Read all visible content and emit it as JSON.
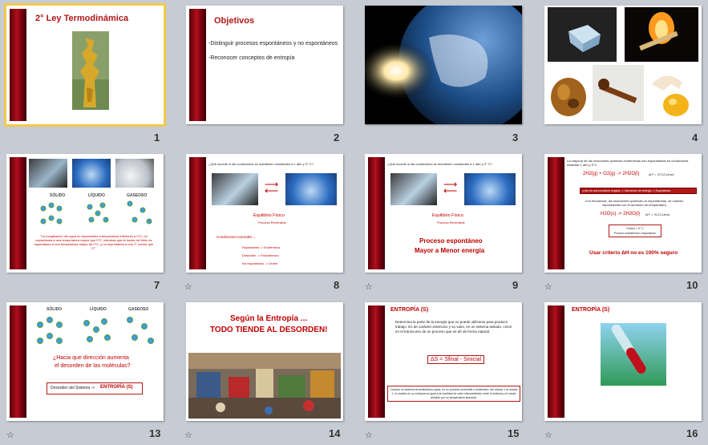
{
  "slides": [
    {
      "num": "1",
      "title": "2° Ley Termodinámica"
    },
    {
      "num": "2",
      "title": "Objetivos",
      "lines": [
        "-Distinguir procesos espontáneos y no espontáneos",
        "-Reconocer conceptos de entropía"
      ]
    },
    {
      "num": "3"
    },
    {
      "num": "4"
    },
    {
      "num": "7",
      "labels": [
        "SÓLIDO",
        "LÍQUIDO",
        "GASEOSO"
      ],
      "quote": "\"La congelación del agua es espontánea a temperatura inferiores a 0°C; no espontánea a una temperatura mayor que 0°C, mientras que la fusión del hielo es espontánea a una temperatura mayor de 0°C, y no espontánea a una T° menor que 0°\""
    },
    {
      "num": "8",
      "question": "¿Qué sucede si las condiciones se mantienen constantes a 1 atm y 0° C?",
      "eq": "Equilibrio Físico",
      "eq_sub": "Proceso Reversible",
      "cond": "Condiciones normales ...",
      "rows": [
        "Espontáneo -> Exotérmico",
        "Desorden -> Endotérmico",
        "No espontáneo -> Orden"
      ]
    },
    {
      "num": "9",
      "question": "¿Qué sucede si las condiciones se mantienen constantes a 1 atm y 0° C?",
      "eq": "Equilibrio Físico",
      "eq_sub": "Proceso Reversible",
      "big": "Proceso espontáneo",
      "big2": "Mayor a Menor energía"
    },
    {
      "num": "10",
      "intro": "La mayoría de las reacciones químicas exotérmicas son espontáneas en condiciones estándar 1 atm y 0°C",
      "eq1": "2H2(g) + O2(g) -> 2H2O(l)",
      "dh1": "ΔH° = -571,6 kJ/mol",
      "box1": "¡¡¡No es una condición mágica -> Liberación de energía -> Espontánea",
      "mid": "Con frecuencia, las reacciones químicas no espontáneas, se vuelven espontáneas con el aumento de temperatura",
      "eq2": "H2O(s) -> 2H2O(l)",
      "dh2": "ΔH° = +6.01 kJ/mol",
      "box2a": "Fusión > 0° C",
      "box2b": "Proceso endotérmico espontáneo",
      "criterio": "Usar criterio  ΔH no es 100% seguro"
    },
    {
      "num": "13",
      "labels": [
        "SÓLIDO",
        "LÍQUIDO",
        "GASEOSO"
      ],
      "q1": "¿Hacia que dirección aumenta",
      "q2": "el desorden de las moléculas?",
      "box_pre": "Desorden del Sistema ->",
      "box_em": "ENTROPÍA (S)"
    },
    {
      "num": "14",
      "line1": "Según la Entropía  ...",
      "line2": "TODO TIENDE AL DESORDEN!"
    },
    {
      "num": "15",
      "title": "ENTROPÍA (S)",
      "body": "Determina la parte de la energía que no puede utilizarse para producir trabajo. Es de carácter extensivo y su valor, en un sistema aislado, crece en el transcurso de un proceso que se dé de forma natural.",
      "formula": "ΔS = Sfinal - Sinicial",
      "box": "Cuando un sistema termodinámico pasa, en un proceso reversible e isotérmico, del estado 1 al estado 2, el cambio en su entropía es igual a la cantidad de calor intercambiado entre el sistema y el medio dividido por su temperatura absoluta."
    },
    {
      "num": "16",
      "title": "ENTROPÍA (S)"
    }
  ]
}
